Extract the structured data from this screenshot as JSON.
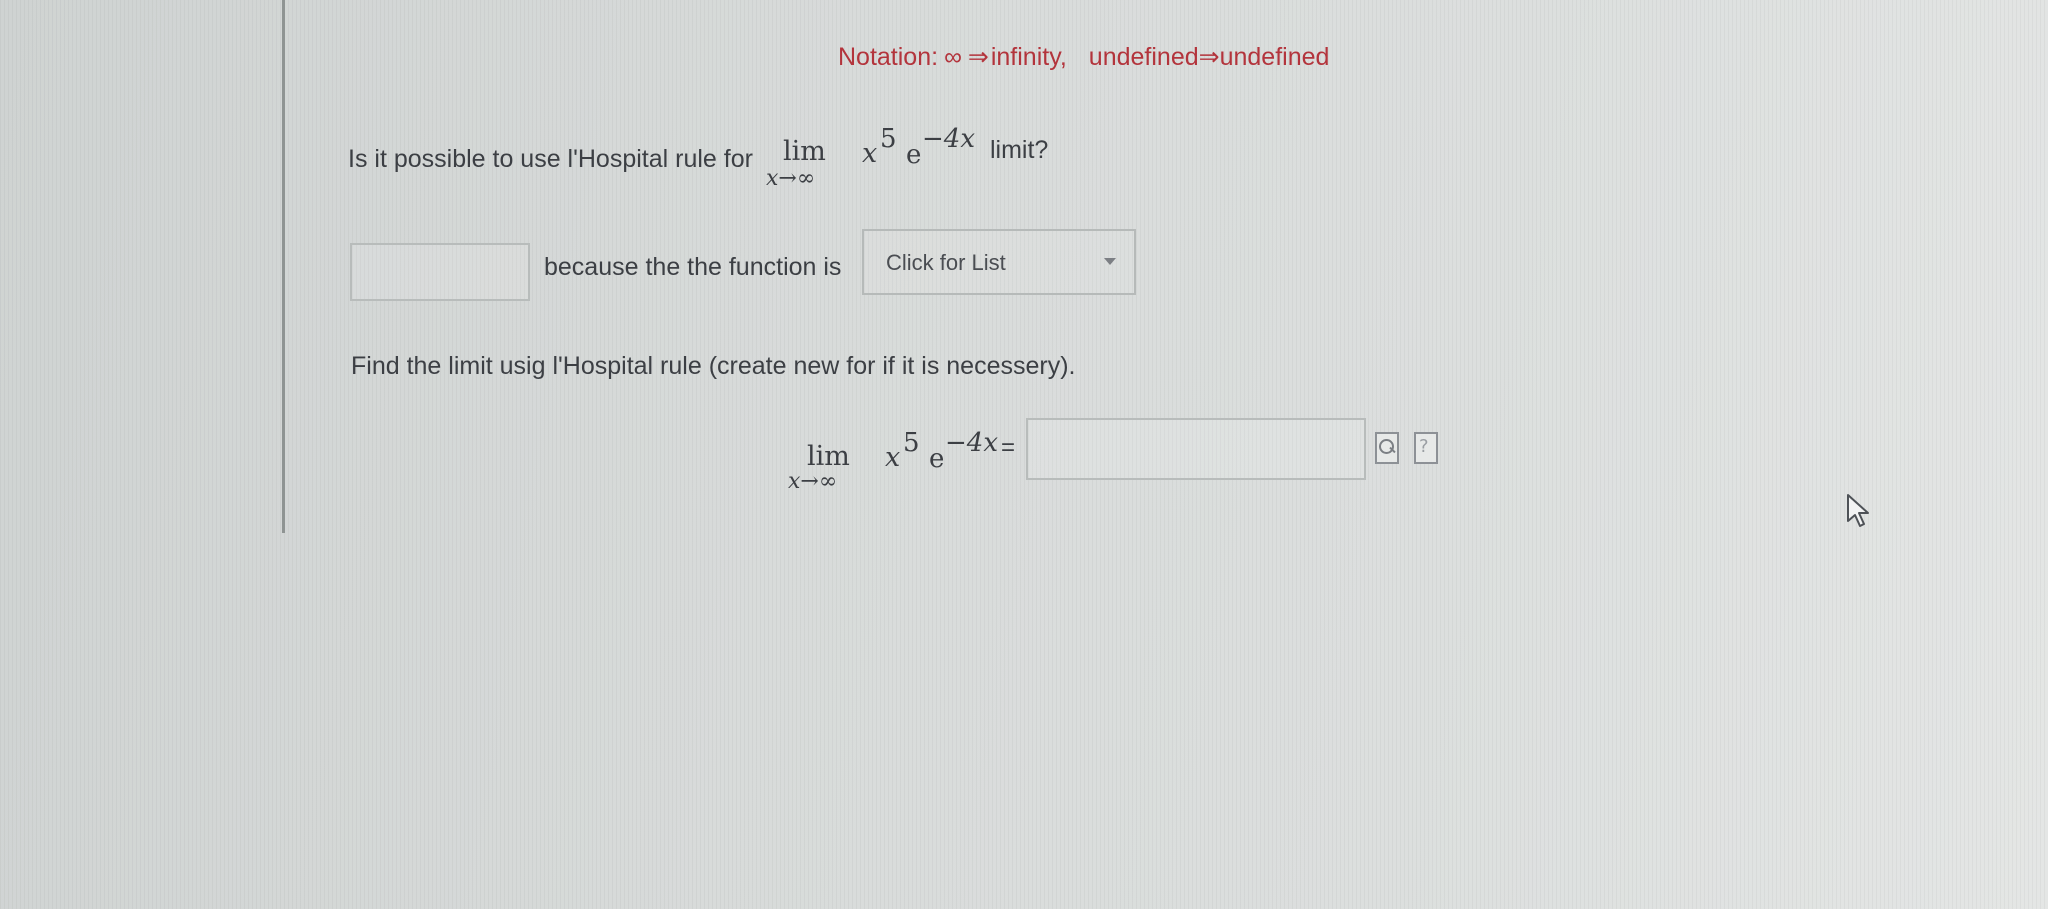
{
  "notation": {
    "prefix": "Notation:",
    "infinity_symbol": "∞",
    "arrow": "⇒",
    "infinity_word": "infinity,",
    "undefined_symbol": "undefined",
    "undefined_word": "undefined"
  },
  "question1": {
    "text_before": "Is it possible to use l'Hospital rule for",
    "text_after": "limit?"
  },
  "expression": {
    "lim": "lim",
    "subscript": "x→∞",
    "base": "x",
    "exponent": "5",
    "e": "e",
    "e_exponent": "−4x"
  },
  "answer_row": {
    "because_text": "because the the function is",
    "dropdown_label": "Click for List"
  },
  "question2": {
    "text": "Find the limit usig l'Hospital rule (create new for if it is necessery).",
    "equals": "="
  },
  "icons": {
    "preview": "preview-icon",
    "help": "help-icon",
    "cursor": "mouse-cursor-icon"
  },
  "colors": {
    "notation_text": "#b3343c",
    "body_text": "#3c3f44",
    "box_border": "#b8bcbb"
  }
}
